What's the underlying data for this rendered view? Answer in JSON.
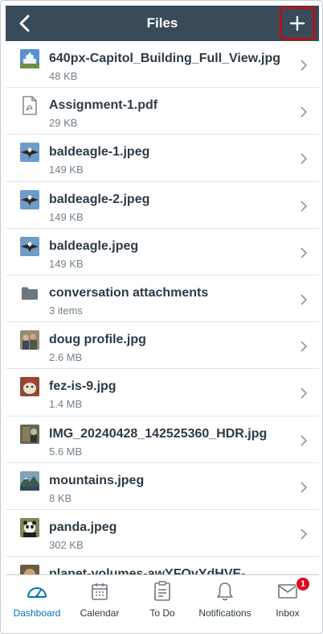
{
  "header": {
    "title": "Files"
  },
  "files": [
    {
      "name": "640px-Capitol_Building_Full_View.jpg",
      "meta": "48 KB",
      "icon": "capitol-thumbnail"
    },
    {
      "name": "Assignment-1.pdf",
      "meta": "29 KB",
      "icon": "pdf-icon"
    },
    {
      "name": "baldeagle-1.jpeg",
      "meta": "149 KB",
      "icon": "eagle-thumbnail"
    },
    {
      "name": "baldeagle-2.jpeg",
      "meta": "149 KB",
      "icon": "eagle-thumbnail"
    },
    {
      "name": "baldeagle.jpeg",
      "meta": "149 KB",
      "icon": "eagle-thumbnail"
    },
    {
      "name": "conversation attachments",
      "meta": "3 items",
      "icon": "folder-icon"
    },
    {
      "name": "doug profile.jpg",
      "meta": "2.6 MB",
      "icon": "doug-thumbnail"
    },
    {
      "name": "fez-is-9.jpg",
      "meta": "1.4 MB",
      "icon": "fez-thumbnail"
    },
    {
      "name": "IMG_20240428_142525360_HDR.jpg",
      "meta": "5.6 MB",
      "icon": "img-thumbnail"
    },
    {
      "name": "mountains.jpeg",
      "meta": "8 KB",
      "icon": "mountains-thumbnail"
    },
    {
      "name": "panda.jpeg",
      "meta": "302 KB",
      "icon": "panda-thumbnail"
    },
    {
      "name": "planet-volumes-awYFOvYdHVE-",
      "meta": "",
      "icon": "planet-thumbnail"
    }
  ],
  "tabs": [
    {
      "label": "Dashboard",
      "icon": "dashboard-icon",
      "active": true
    },
    {
      "label": "Calendar",
      "icon": "calendar-icon"
    },
    {
      "label": "To Do",
      "icon": "todo-icon"
    },
    {
      "label": "Notifications",
      "icon": "bell-icon"
    },
    {
      "label": "Inbox",
      "icon": "inbox-icon",
      "badge": "1"
    }
  ],
  "colors": {
    "header_bg": "#394b58",
    "accent": "#0374b5",
    "highlight_border": "#b4111a",
    "badge": "#e0061f"
  }
}
